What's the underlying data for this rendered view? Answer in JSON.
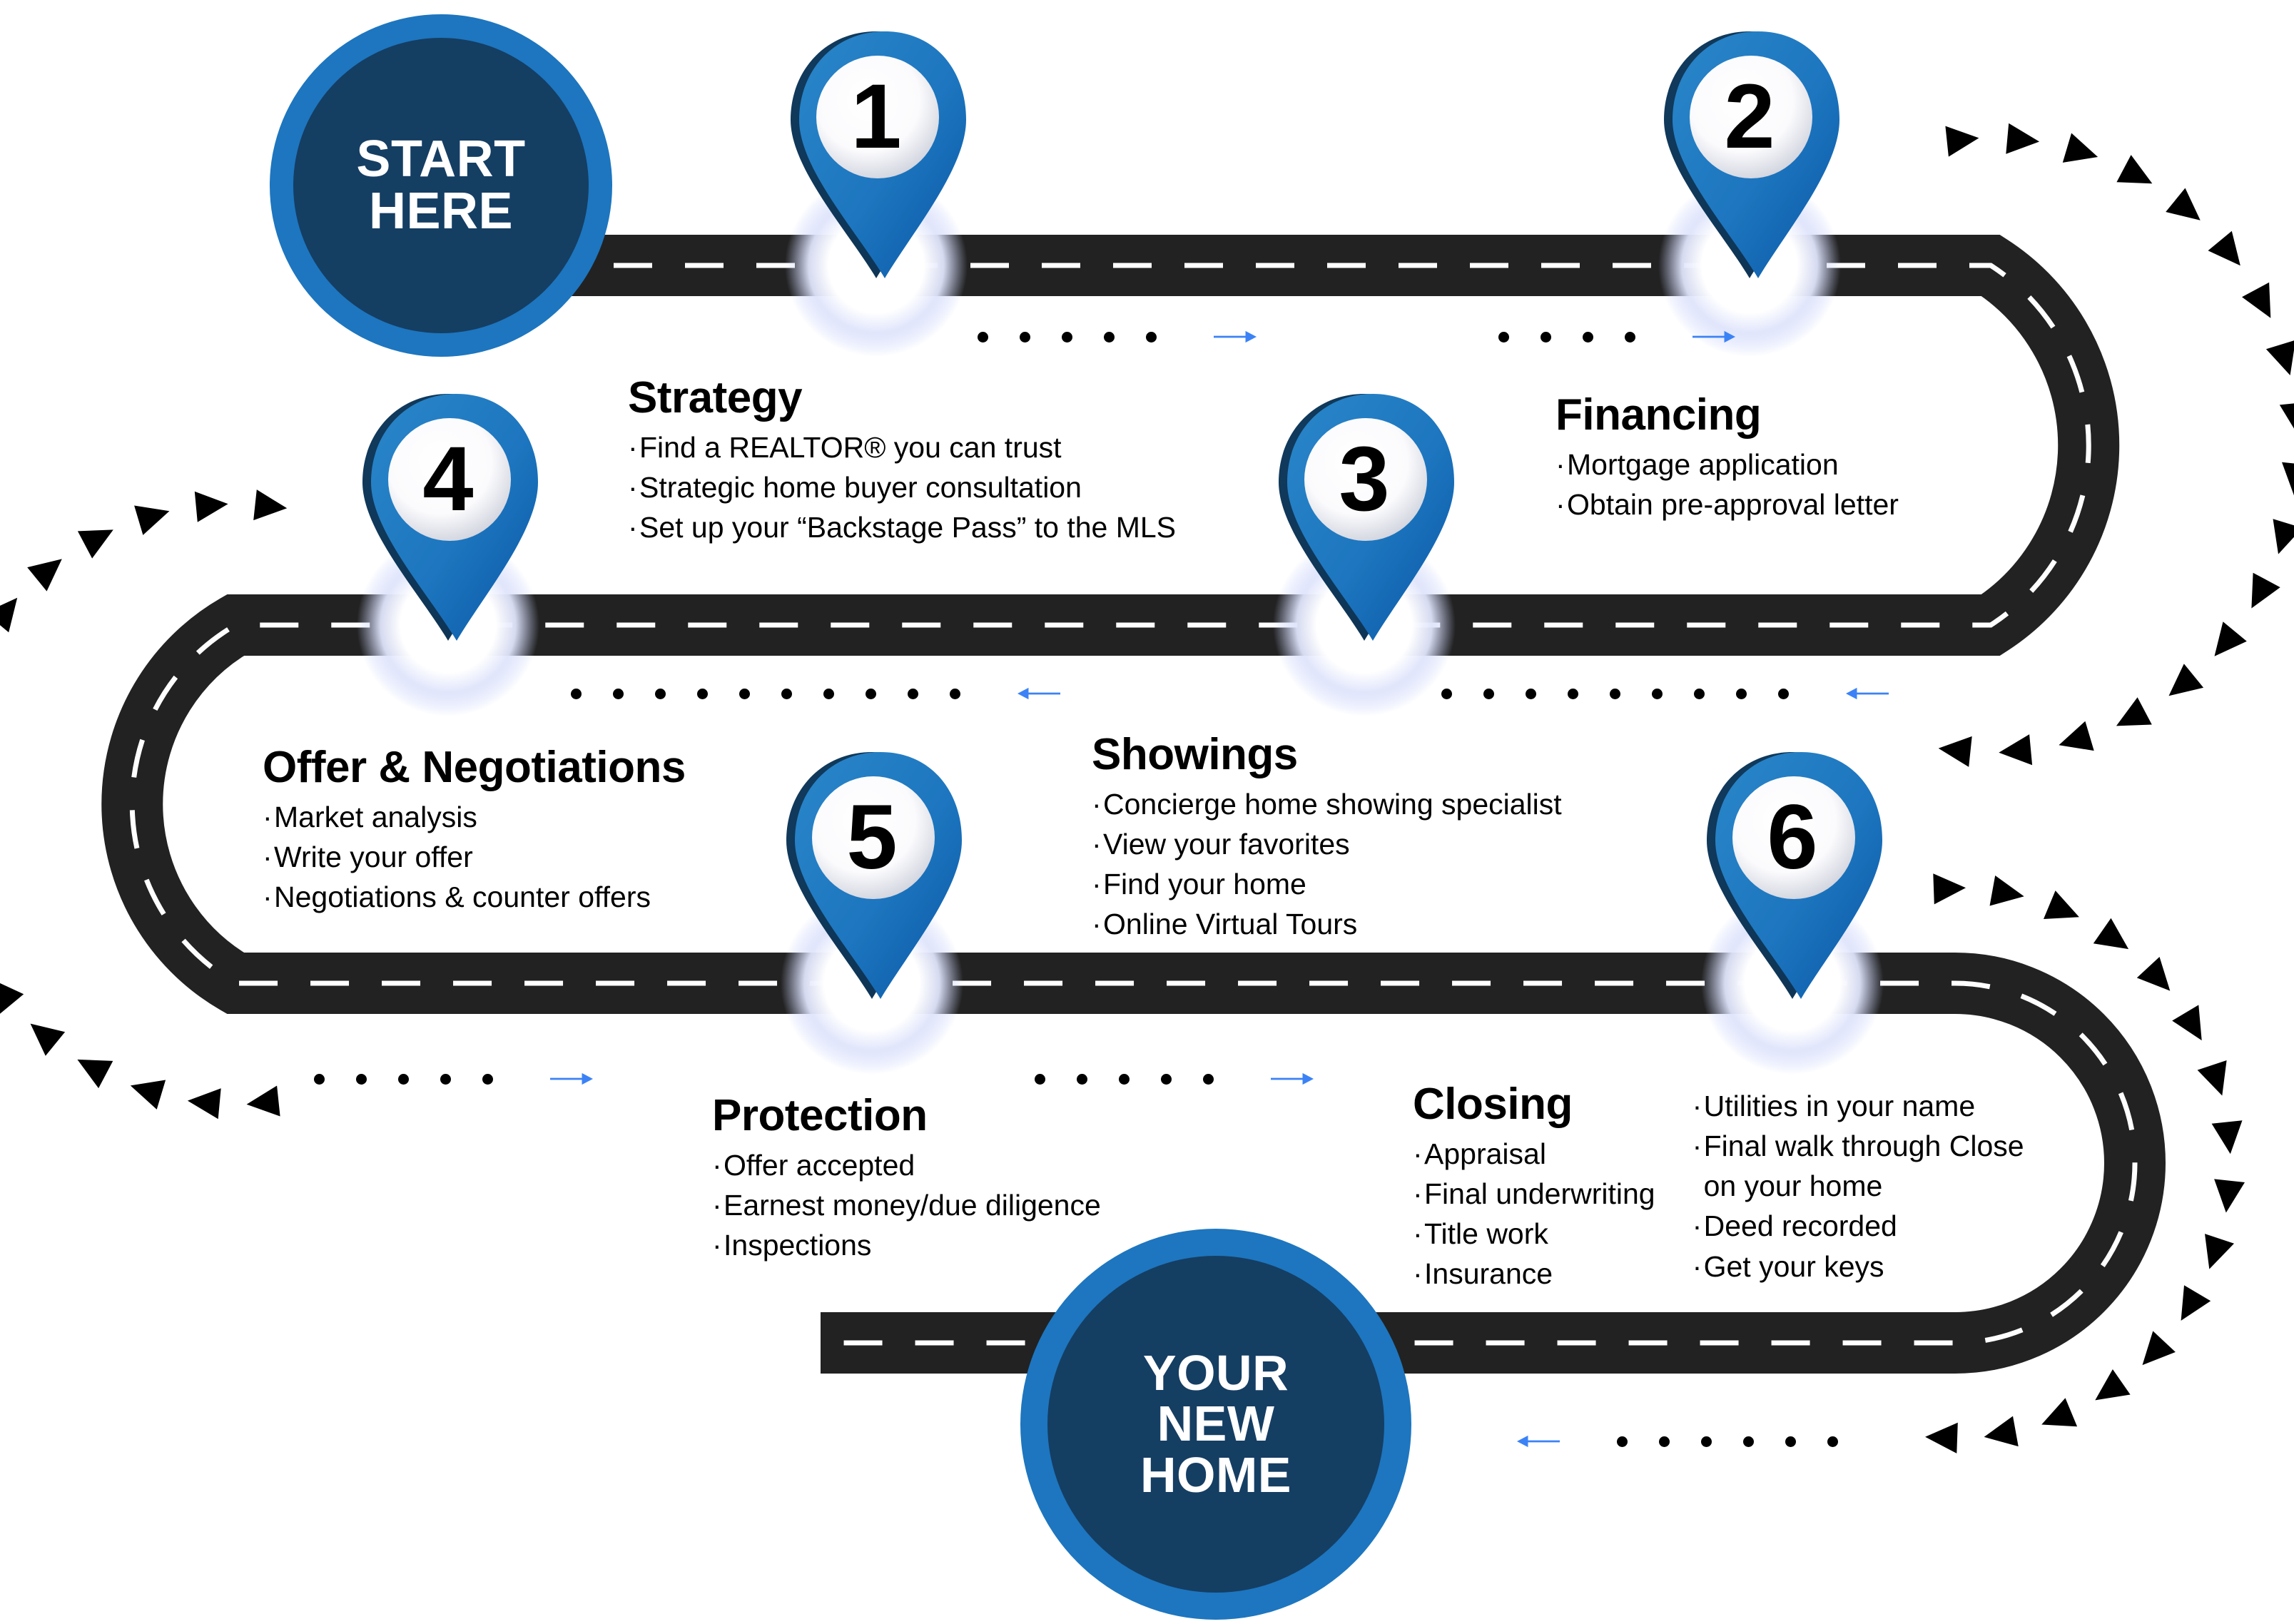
{
  "meta": {
    "title": "Home Buying Roadmap",
    "road_color": "#222222",
    "lane_color": "#ffffff",
    "accent_blue": "#1d76bf",
    "deep_navy": "#153e63",
    "arrow_blue": "#3b82f6",
    "pin_blue_light": "#2079bf",
    "pin_blue_dark": "#0b5fae",
    "pin_shadow": "#133b5c"
  },
  "terminals": {
    "start": {
      "name": "start-here",
      "lines": [
        "START",
        "HERE"
      ]
    },
    "end": {
      "name": "your-new-home",
      "lines": [
        "YOUR",
        "NEW",
        "HOME"
      ]
    }
  },
  "pins": [
    {
      "number": "1",
      "step": "strategy"
    },
    {
      "number": "2",
      "step": "financing"
    },
    {
      "number": "3",
      "step": "showings"
    },
    {
      "number": "4",
      "step": "offer-negotiations"
    },
    {
      "number": "5",
      "step": "protection"
    },
    {
      "number": "6",
      "step": "closing"
    }
  ],
  "steps": [
    {
      "id": "strategy",
      "title": "Strategy",
      "items": [
        "Find a REALTOR® you can trust",
        "Strategic home buyer consultation",
        "Set up your “Backstage Pass” to the MLS"
      ]
    },
    {
      "id": "financing",
      "title": "Financing",
      "items": [
        "Mortgage  application",
        "Obtain pre-approval letter"
      ]
    },
    {
      "id": "offer",
      "title": "Offer & Negotiations",
      "items": [
        "Market analysis",
        "Write your offer",
        "Negotiations & counter offers"
      ]
    },
    {
      "id": "showings",
      "title": "Showings",
      "items": [
        "Concierge home showing specialist",
        "View your favorites",
        "Find your home",
        "Online Virtual Tours"
      ]
    },
    {
      "id": "protection",
      "title": "Protection",
      "items": [
        "Offer accepted",
        "Earnest money/due diligence",
        "Inspections"
      ]
    },
    {
      "id": "closing",
      "title": "Closing",
      "items": [
        "Appraisal",
        "Final underwriting",
        "Title work",
        "Insurance"
      ],
      "items_right": [
        "Utilities in your name",
        "Final walk through Close",
        "on your home",
        "Deed recorded",
        "Get your keys"
      ]
    }
  ],
  "connectors": [
    {
      "id": "c1",
      "direction": "right",
      "dots": 5
    },
    {
      "id": "c2",
      "direction": "right",
      "dots": 4
    },
    {
      "id": "c3",
      "direction": "left",
      "dots": 10
    },
    {
      "id": "c4",
      "direction": "left",
      "dots": 9
    },
    {
      "id": "c5",
      "direction": "right",
      "dots": 5
    },
    {
      "id": "c6",
      "direction": "right",
      "dots": 5
    },
    {
      "id": "c7",
      "direction": "left",
      "dots": 6
    }
  ]
}
